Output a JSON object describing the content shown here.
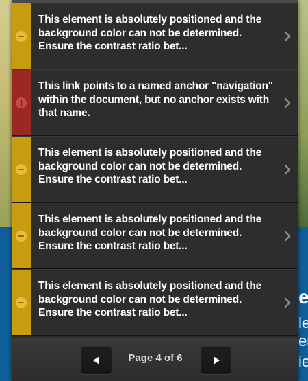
{
  "issues": [
    {
      "severity": "warning",
      "icon": "warning-dash-icon",
      "message": "This element is absolutely positioned and the background color can not be determined. Ensure the contrast ratio bet..."
    },
    {
      "severity": "error",
      "icon": "error-exclamation-icon",
      "message": "This link points to a named anchor \"navigation\" within the document, but no anchor exists with that name."
    },
    {
      "severity": "warning",
      "icon": "warning-dash-icon",
      "message": "This element is absolutely positioned and the background color can not be determined. Ensure the contrast ratio bet..."
    },
    {
      "severity": "warning",
      "icon": "warning-dash-icon",
      "message": "This element is absolutely positioned and the background color can not be determined. Ensure the contrast ratio bet..."
    },
    {
      "severity": "warning",
      "icon": "warning-dash-icon",
      "message": "This element is absolutely positioned and the background color can not be determined. Ensure the contrast ratio bet..."
    }
  ],
  "pager": {
    "label": "Page 4 of 6",
    "prev_icon": "triangle-left-icon",
    "next_icon": "triangle-right-icon"
  },
  "background": {
    "fragments": [
      "e",
      "le",
      "er",
      "ie"
    ]
  },
  "colors": {
    "warning": "#c79c0e",
    "error": "#9a2823",
    "panel": "#2d2d2d",
    "page_blue": "#0f5f9a"
  }
}
